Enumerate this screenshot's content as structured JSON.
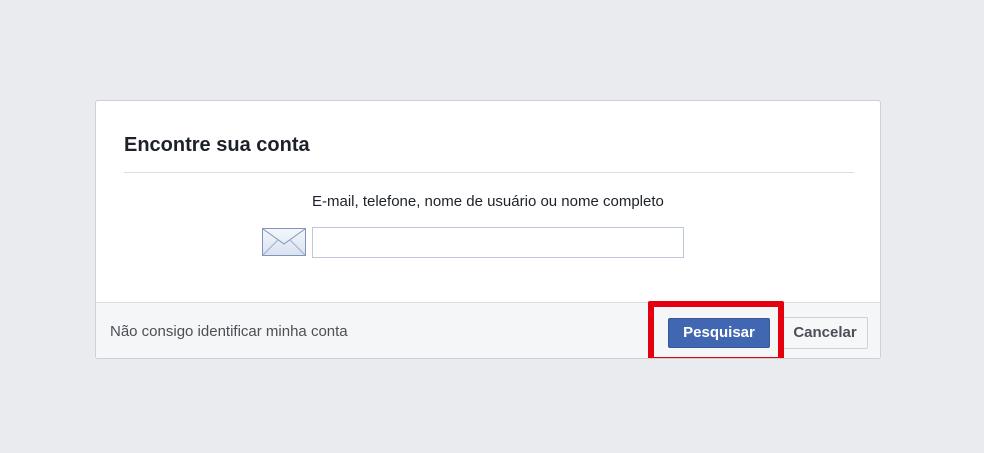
{
  "dialog": {
    "title": "Encontre sua conta",
    "field_label": "E-mail, telefone, nome de usuário ou nome completo",
    "input_value": "",
    "input_placeholder": "",
    "icon": "envelope-icon"
  },
  "footer": {
    "cant_identify_link": "Não consigo identificar minha conta",
    "search_label": "Pesquisar",
    "cancel_label": "Cancelar"
  },
  "colors": {
    "primary_button": "#4267b2",
    "highlight": "#e4000f",
    "background": "#e9ebee"
  }
}
